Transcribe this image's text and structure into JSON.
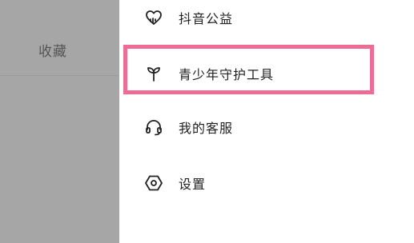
{
  "left_pane": {
    "tab_label": "收藏"
  },
  "menu": {
    "items": [
      {
        "label": "抖音公益",
        "icon": "heart-cloud-icon"
      },
      {
        "label": "青少年守护工具",
        "icon": "sprout-icon"
      },
      {
        "label": "我的客服",
        "icon": "headset-icon"
      },
      {
        "label": "设置",
        "icon": "hexagon-settings-icon"
      }
    ]
  },
  "highlight": {
    "color": "#ec6c94",
    "target": "青少年守护工具"
  }
}
